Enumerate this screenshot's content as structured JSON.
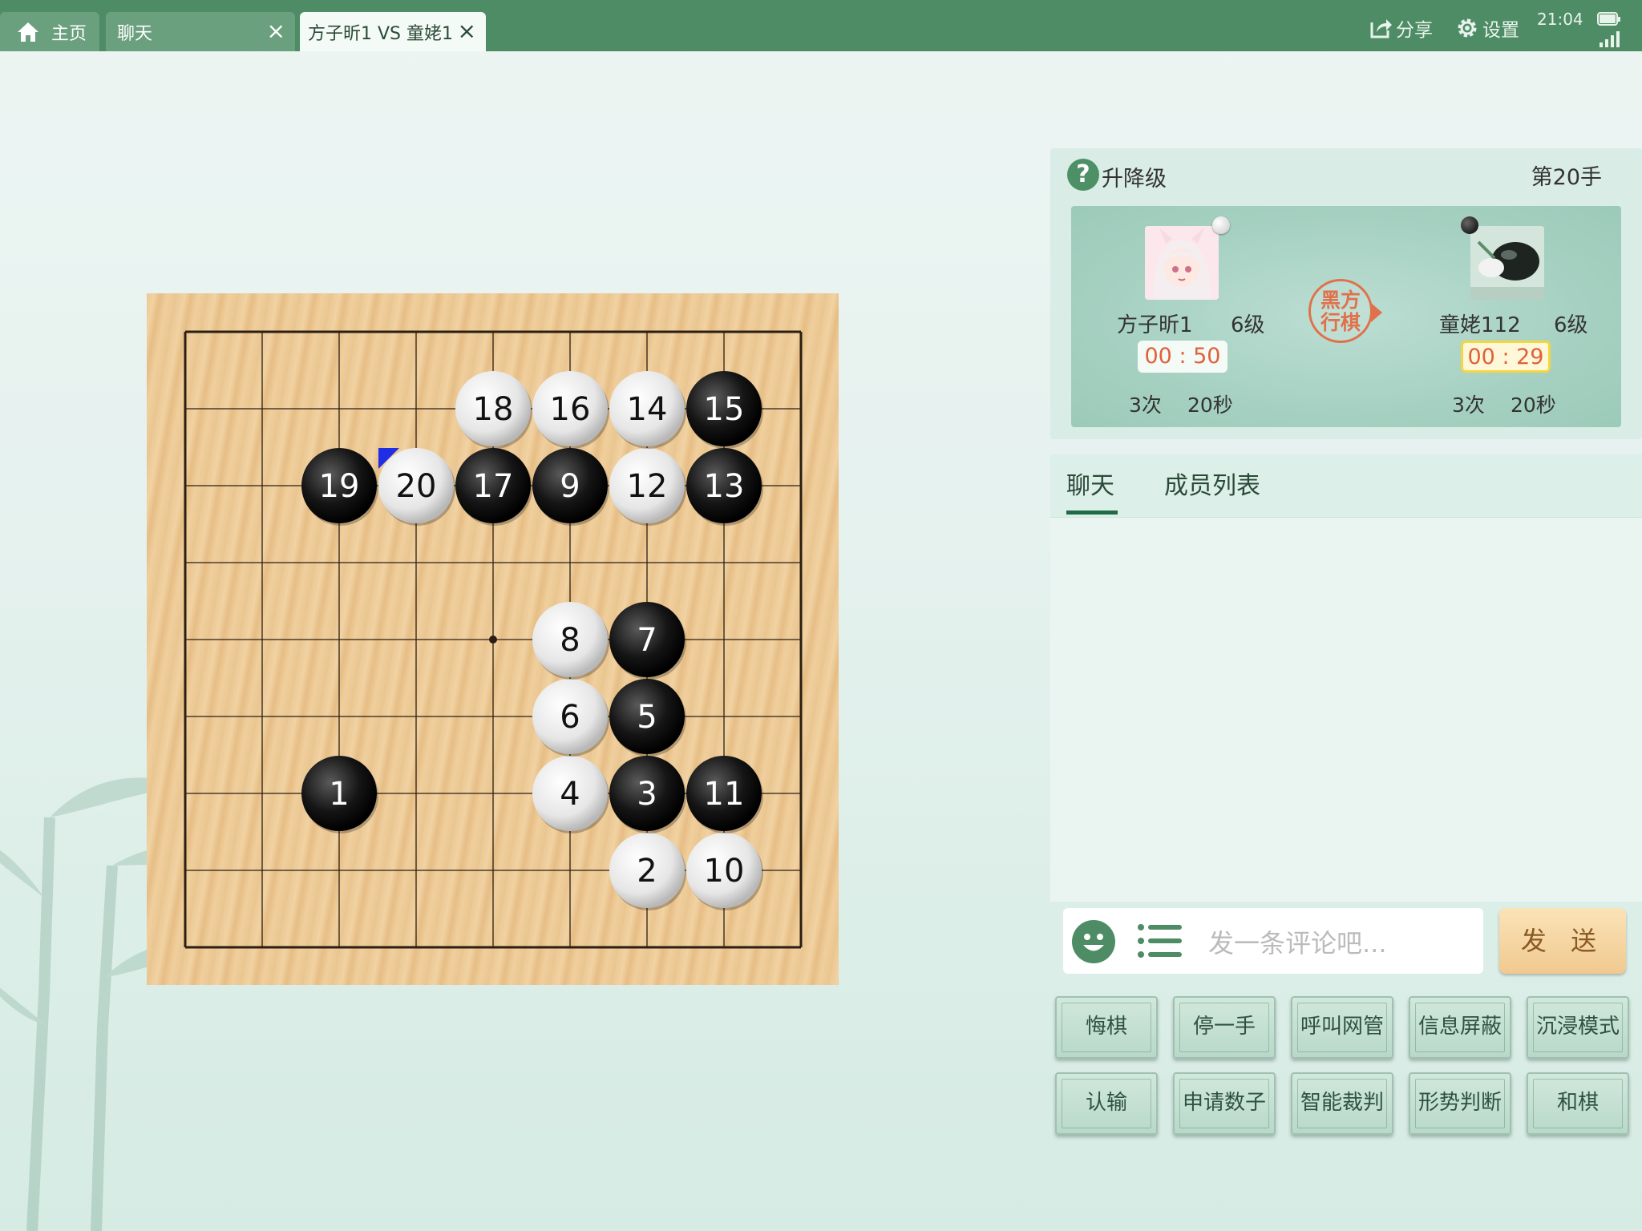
{
  "topbar": {
    "tabs": [
      {
        "label": "主页",
        "closable": false,
        "active": false
      },
      {
        "label": "聊天",
        "closable": true,
        "active": false
      },
      {
        "label": "方子昕1 VS 童姥1",
        "closable": true,
        "active": true
      }
    ],
    "share_label": "分享",
    "settings_label": "设置",
    "time": "21:04"
  },
  "game": {
    "mode_label": "升降级",
    "move_label": "第20手",
    "turn_stamp_line1": "黑方",
    "turn_stamp_line2": "行棋",
    "player_white": {
      "name": "方子昕1",
      "rank": "6级",
      "timer": "00 : 50",
      "byoyomi_count": "3次",
      "byoyomi_time": "20秒",
      "stone": "white"
    },
    "player_black": {
      "name": "童姥112",
      "rank": "6级",
      "timer": "00 : 29",
      "byoyomi_count": "3次",
      "byoyomi_time": "20秒",
      "stone": "black",
      "active": true
    }
  },
  "board": {
    "size": 9,
    "stones": [
      {
        "n": 1,
        "color": "black",
        "col": 2,
        "row": 6
      },
      {
        "n": 2,
        "color": "white",
        "col": 6,
        "row": 7
      },
      {
        "n": 3,
        "color": "black",
        "col": 6,
        "row": 6
      },
      {
        "n": 4,
        "color": "white",
        "col": 5,
        "row": 6
      },
      {
        "n": 5,
        "color": "black",
        "col": 6,
        "row": 5
      },
      {
        "n": 6,
        "color": "white",
        "col": 5,
        "row": 5
      },
      {
        "n": 7,
        "color": "black",
        "col": 6,
        "row": 4
      },
      {
        "n": 8,
        "color": "white",
        "col": 5,
        "row": 4
      },
      {
        "n": 9,
        "color": "black",
        "col": 5,
        "row": 2
      },
      {
        "n": 10,
        "color": "white",
        "col": 7,
        "row": 7
      },
      {
        "n": 11,
        "color": "black",
        "col": 7,
        "row": 6
      },
      {
        "n": 12,
        "color": "white",
        "col": 6,
        "row": 2
      },
      {
        "n": 13,
        "color": "black",
        "col": 7,
        "row": 2
      },
      {
        "n": 14,
        "color": "white",
        "col": 6,
        "row": 1
      },
      {
        "n": 15,
        "color": "black",
        "col": 7,
        "row": 1
      },
      {
        "n": 16,
        "color": "white",
        "col": 5,
        "row": 1
      },
      {
        "n": 17,
        "color": "black",
        "col": 4,
        "row": 2
      },
      {
        "n": 18,
        "color": "white",
        "col": 4,
        "row": 1
      },
      {
        "n": 19,
        "color": "black",
        "col": 2,
        "row": 2
      },
      {
        "n": 20,
        "color": "white",
        "col": 3,
        "row": 2
      }
    ],
    "last_move": 20,
    "star_points": [
      {
        "col": 4,
        "row": 4
      },
      {
        "col": 2,
        "row": 6
      }
    ]
  },
  "chat": {
    "tab_chat": "聊天",
    "tab_members": "成员列表",
    "input_placeholder": "发一条评论吧...",
    "send_label": "发 送"
  },
  "actions": {
    "row1": [
      "悔棋",
      "停一手",
      "呼叫网管",
      "信息屏蔽",
      "沉浸模式"
    ],
    "row2": [
      "认输",
      "申请数子",
      "智能裁判",
      "形势判断",
      "和棋"
    ]
  }
}
